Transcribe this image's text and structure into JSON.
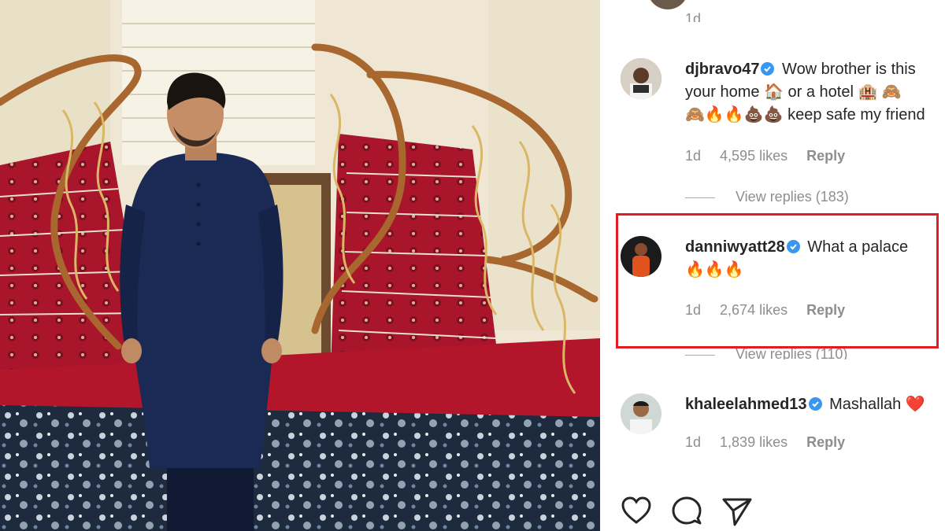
{
  "top_fragment": "1d",
  "comments": [
    {
      "username": "djbravo47",
      "text_line1": "Wow brother is this",
      "text_line2": "your home 🏠 or a hotel 🏨 🙈",
      "text_line3": "🙈🔥🔥💩💩 keep safe my friend",
      "time": "1d",
      "likes": "4,595 likes",
      "reply": "Reply",
      "view_replies": "View replies (183)"
    },
    {
      "username": "danniwyatt28",
      "text_line1": "What a palace",
      "text_line2": "🔥🔥🔥",
      "time": "1d",
      "likes": "2,674 likes",
      "reply": "Reply",
      "view_replies": "View replies (110)"
    },
    {
      "username": "khaleelahmed13",
      "text_line1": "Mashallah ❤️",
      "time": "1d",
      "likes": "1,839 likes",
      "reply": "Reply"
    }
  ],
  "icons": [
    "heart-icon",
    "comment-icon",
    "share-icon"
  ],
  "colors": {
    "highlight": "#e31b23",
    "verified": "#3897f0",
    "meta_text": "#8e8e8e",
    "carpet_red": "#b3152a",
    "outfit_navy": "#1b2a55"
  }
}
